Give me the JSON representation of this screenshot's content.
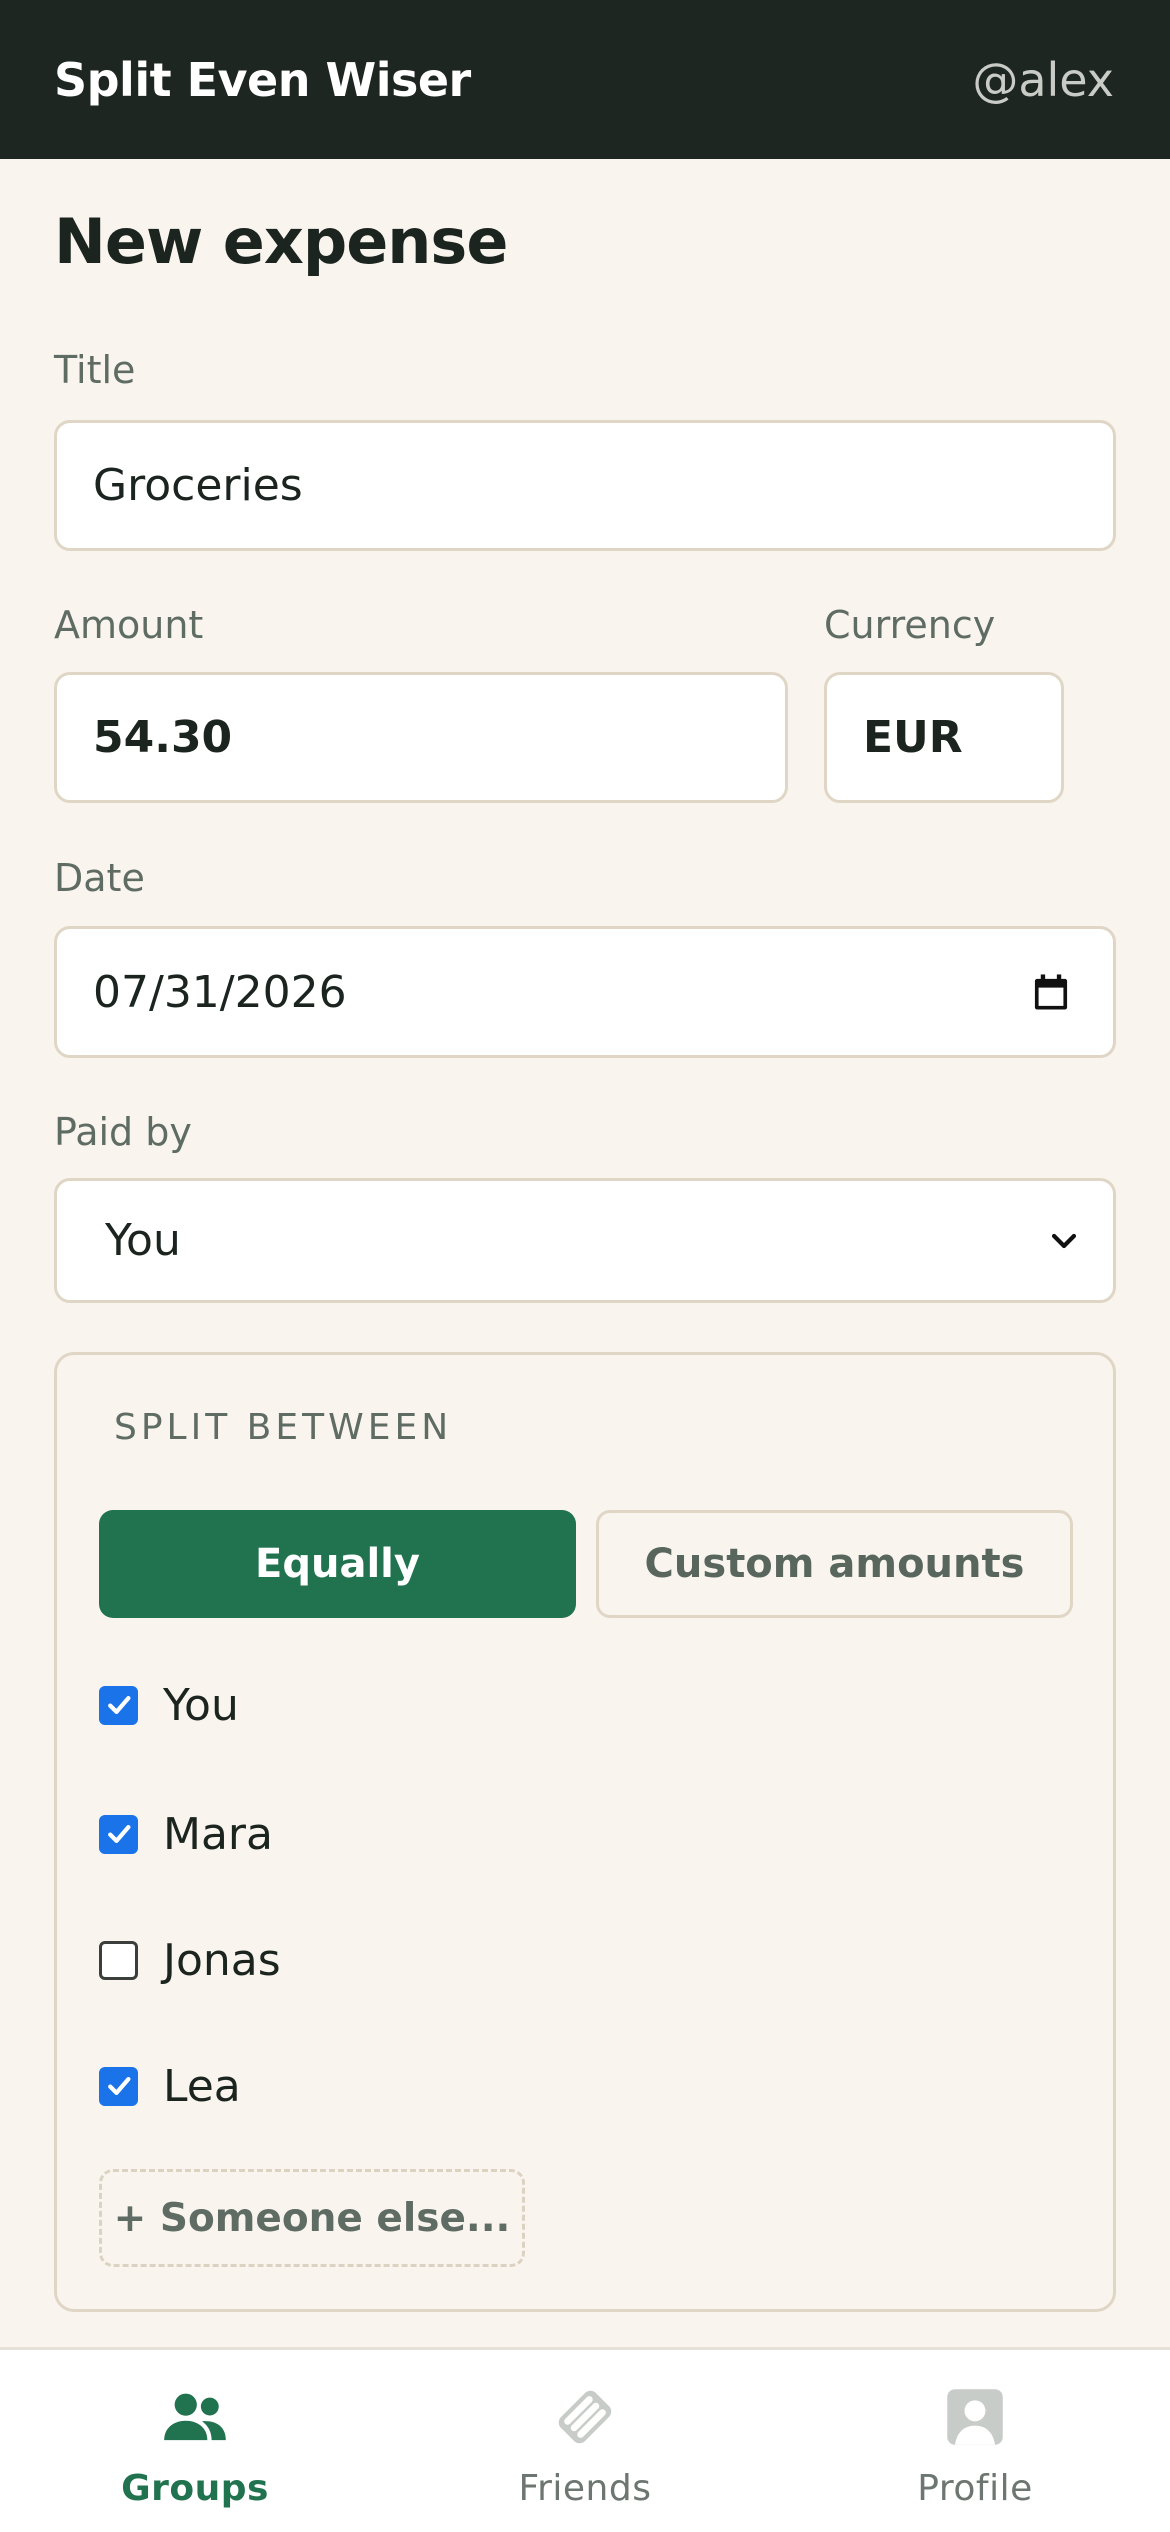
{
  "header": {
    "app_title": "Split Even Wiser",
    "username": "@alex"
  },
  "page": {
    "title": "New expense"
  },
  "form": {
    "title_label": "Title",
    "title_value": "Groceries",
    "amount_label": "Amount",
    "amount_value": "54.30",
    "currency_label": "Currency",
    "currency_value": "EUR",
    "date_label": "Date",
    "date_value": "07/31/2026",
    "paid_by_label": "Paid by",
    "paid_by_value": "You"
  },
  "split": {
    "heading": "SPLIT BETWEEN",
    "mode_equal": "Equally",
    "mode_custom": "Custom amounts",
    "selected_mode": "Equally",
    "members": [
      {
        "name": "You",
        "checked": true
      },
      {
        "name": "Mara",
        "checked": true
      },
      {
        "name": "Jonas",
        "checked": false
      },
      {
        "name": "Lea",
        "checked": true
      }
    ],
    "add_label": "+ Someone else..."
  },
  "nav": {
    "items": [
      {
        "label": "Groups",
        "icon": "groups-icon",
        "active": true
      },
      {
        "label": "Friends",
        "icon": "handshake-icon",
        "active": false
      },
      {
        "label": "Profile",
        "icon": "profile-icon",
        "active": false
      }
    ]
  },
  "colors": {
    "header_bg": "#1e2621",
    "page_bg": "#f9f5ee",
    "accent_green": "#217350",
    "checkbox_blue": "#1a73e8",
    "border": "#e0d6c6"
  }
}
